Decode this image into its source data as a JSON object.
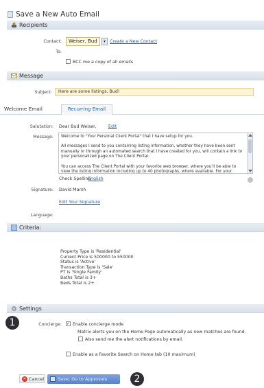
{
  "window": {
    "title": "Save a New Auto Email"
  },
  "recipients": {
    "section_label": "Recipients",
    "contact_label": "Contact:",
    "contact_value": "Weiser, Bud",
    "create_contact_link": "Create a New Contact",
    "to_label": "To:",
    "bcc_label": "BCC me a copy of all emails"
  },
  "message": {
    "section_label": "Message",
    "subject_label": "Subject:",
    "subject_value": "Here are some listings, Bud!"
  },
  "tabs": {
    "welcome": "Welcome Email",
    "recurring": "Recurring Email"
  },
  "welcome": {
    "salutation_label": "Salutation:",
    "salutation_value": "Dear Bud Weiser,",
    "edit_link": "Edit",
    "message_label": "Message:",
    "body_p1": "Welcome to \"Your Personal Client Portal\" that I have setup for you.",
    "body_p2": "All messages I send to you containing listing information, whether they have been sent manually or through an automated search that I have created for you, will contain a link to your personalized page on The Client Portal.",
    "body_p3": "You can access The Client Portal with your favorite web browser, where you'll be able to view the listing information including up to 40 photographs, where available. For your convenience, you'll be able to sort these listings, rate them and categorize them.",
    "check_spelling": "Check Spelling",
    "spelling_lang": "English",
    "signature_label": "Signature:",
    "signature_value": "David Marsh",
    "edit_signature_link": "Edit Your Signature",
    "language_label": "Language:"
  },
  "criteria": {
    "section_label": "Criteria:",
    "lines": [
      "Property Type is 'Residential'",
      "Current Price is 500000 to 550000",
      "Status is 'Active'",
      "Transaction Type is 'Sale'",
      "PT is 'Single Family'",
      "Baths Total is 3+",
      "Beds Total is 2+"
    ]
  },
  "settings": {
    "section_label": "Settings",
    "concierge_label": "Concierge:",
    "enable_concierge": "Enable concierge mode",
    "concierge_desc": "Matrix alerts you on the Home Page automatically as new matches are found.",
    "also_send": "Also send me the alert notifications by email.",
    "favorite_search": "Enable as a Favorite Search on Home tab (10 maximum)"
  },
  "buttons": {
    "cancel": "Cancel",
    "save": "Save; Go to Approvals"
  },
  "callouts": {
    "one": "1",
    "two": "2"
  },
  "colors": {
    "section_bg": "#dde4ec",
    "subject_bg": "#fff4d2",
    "save_btn": "#6b90d4",
    "link": "#1f5fb8"
  }
}
